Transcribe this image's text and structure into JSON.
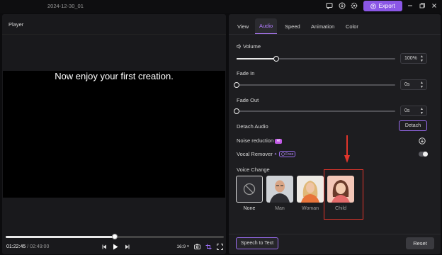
{
  "titlebar": {
    "project_name": "2024-12-30_01",
    "export_label": "Export",
    "accent": "#8b57e6"
  },
  "player": {
    "label": "Player",
    "caption": "Now enjoy your first creation.",
    "current_time": "01:22:45",
    "separator": " / ",
    "total_time": "02:49:00",
    "progress_fraction": 0.5,
    "aspect": "16:9",
    "aspect_chevron": "▾"
  },
  "tabs": [
    {
      "label": "View",
      "active": false
    },
    {
      "label": "Audio",
      "active": true
    },
    {
      "label": "Speed",
      "active": false
    },
    {
      "label": "Animation",
      "active": false
    },
    {
      "label": "Color",
      "active": false
    }
  ],
  "audio": {
    "volume": {
      "label": "Volume",
      "value": "100%",
      "fraction": 0.25
    },
    "fade_in": {
      "label": "Fade In",
      "value": "0s",
      "fraction": 0
    },
    "fade_out": {
      "label": "Fade Out",
      "value": "0s",
      "fraction": 0
    },
    "detach": {
      "label": "Detach Audio",
      "button": "Detach"
    },
    "noise_reduction": {
      "label": "Noise reduction",
      "badge": "AI"
    },
    "vocal_remover": {
      "label": "Vocal Remover",
      "badge": "Free"
    },
    "voice_change": {
      "label": "Voice Change",
      "options": [
        {
          "name": "None"
        },
        {
          "name": "Man"
        },
        {
          "name": "Woman"
        },
        {
          "name": "Child"
        }
      ]
    }
  },
  "footer": {
    "speech_to_text": "Speech to Text",
    "reset": "Reset"
  },
  "colors": {
    "highlight": "#e0352b",
    "tab_active": "#b27cff"
  }
}
